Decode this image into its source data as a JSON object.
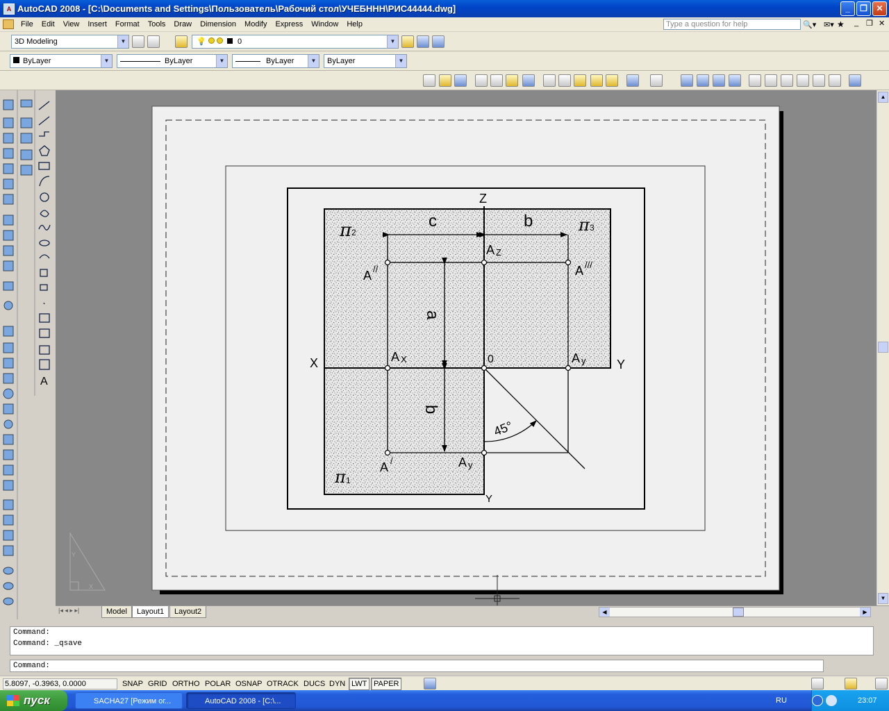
{
  "window": {
    "title": "AutoCAD 2008 - [C:\\Documents and Settings\\Пользователь\\Рабочий стол\\УЧЕБННН\\РИС44444.dwg]",
    "app_icon": "autocad-icon"
  },
  "menu": [
    "File",
    "Edit",
    "View",
    "Insert",
    "Format",
    "Tools",
    "Draw",
    "Dimension",
    "Modify",
    "Express",
    "Window",
    "Help"
  ],
  "help": {
    "placeholder": "Type a question for help"
  },
  "toolbar": {
    "workspace": "3D Modeling",
    "layer": "0",
    "color": "ByLayer",
    "linetype": "ByLayer",
    "lineweight": "ByLayer",
    "plotstyle": "ByLayer"
  },
  "drawing": {
    "labels": {
      "z": "Z",
      "x": "X",
      "y_right": "Y",
      "y_bottom": "Y",
      "pi2": "π",
      "pi2_sub": "2",
      "pi3": "π",
      "pi3_sub": "3",
      "pi1": "π",
      "pi1_sub": "1",
      "c": "c",
      "b_top": "b",
      "a": "a",
      "b_left": "b",
      "az": "A",
      "az_sub": "Z",
      "a2": "A",
      "a2_mark": "//",
      "a3": "A",
      "a3_mark": "///",
      "ax": "A",
      "ax_sub": "X",
      "origin": "0",
      "ay_right": "A",
      "ay_right_sub": "y",
      "ay_bottom": "A",
      "ay_bottom_sub": "y",
      "a1": "A",
      "a1_mark": "/",
      "angle": "45°"
    }
  },
  "tabs": [
    "Model",
    "Layout1",
    "Layout2"
  ],
  "command": {
    "history": [
      "Command:",
      "Command: _qsave"
    ],
    "prompt": "Command:"
  },
  "status": {
    "coords": "5.8097, -0.3963, 0.0000",
    "toggles": [
      "SNAP",
      "GRID",
      "ORTHO",
      "POLAR",
      "OSNAP",
      "OTRACK",
      "DUCS",
      "DYN",
      "LWT",
      "PAPER"
    ]
  },
  "taskbar": {
    "start": "пуск",
    "tasks": [
      "SACHA27 [Режим ог...",
      "AutoCAD 2008 - [C:\\..."
    ],
    "lang": "RU",
    "time": "23:07"
  }
}
